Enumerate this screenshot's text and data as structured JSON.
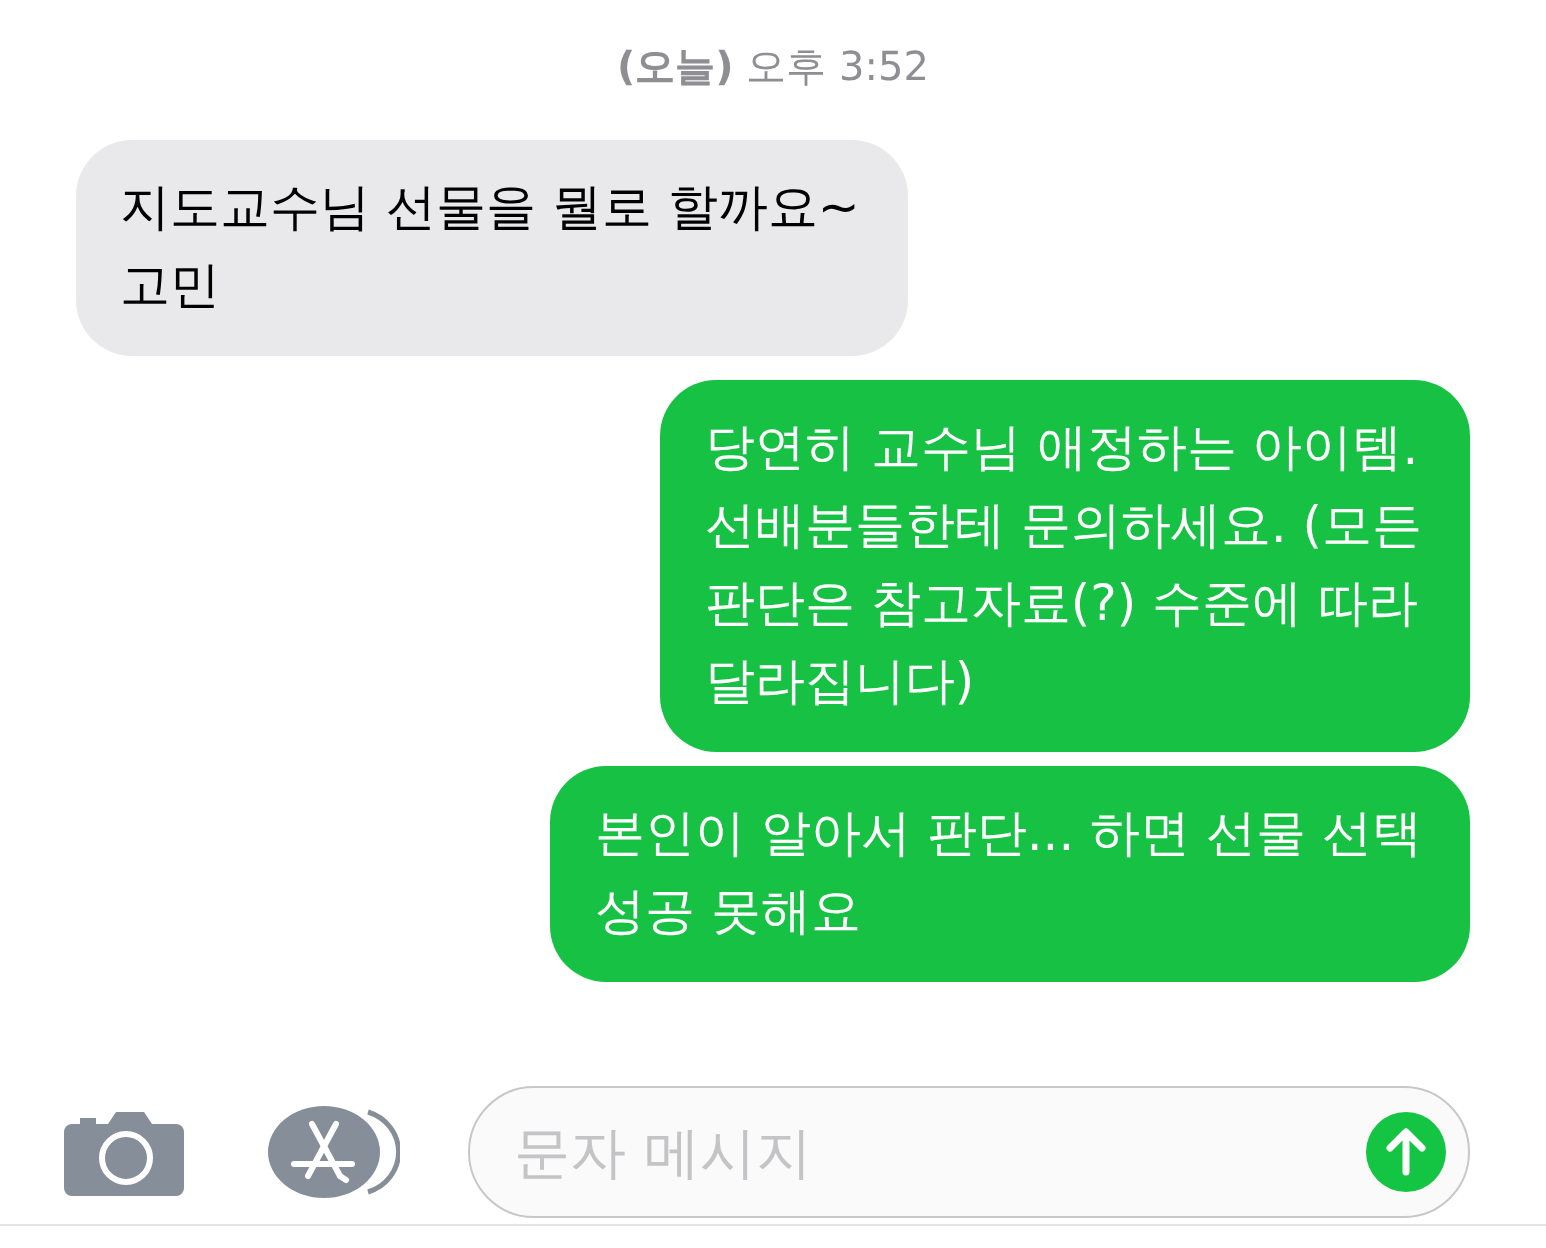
{
  "timestamp": "**(오늘)** 오후 3:52",
  "messages": [
    {
      "kind": "incoming",
      "text": "지도교수님 선물을 뭘로 할까요~\n고민"
    },
    {
      "kind": "outgoing",
      "text": "당연히 교수님 애정하는 아이템.\n선배분들한테 문의하세요. (모든\n판단은 참고자료(?) 수준에 따라\n달라집니다)"
    },
    {
      "kind": "outgoing",
      "text": "본인이 알아서 판단... 하면 선물 선택\n성공 못해요"
    }
  ],
  "composer": {
    "placeholder": "문자 메시지"
  }
}
